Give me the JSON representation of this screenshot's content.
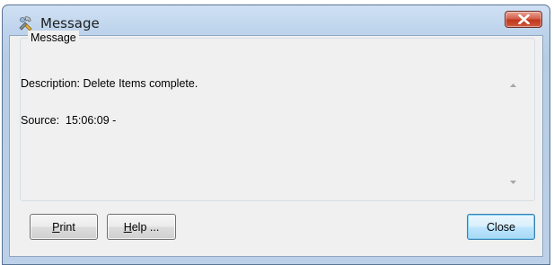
{
  "window": {
    "title": "Message",
    "icon": "tools-icon",
    "close_icon": "close-icon"
  },
  "group": {
    "legend": "Message"
  },
  "message": {
    "description": "Description: Delete Items complete.",
    "source": "Source:  15:06:09 -"
  },
  "buttons": {
    "print_mnemonic": "P",
    "print_rest": "rint",
    "help_mnemonic": "H",
    "help_rest": "elp ...",
    "close": "Close"
  },
  "colors": {
    "close_button": "#c73b22",
    "frame": "#bed4ec",
    "default_button_border": "#3c7fb1"
  }
}
